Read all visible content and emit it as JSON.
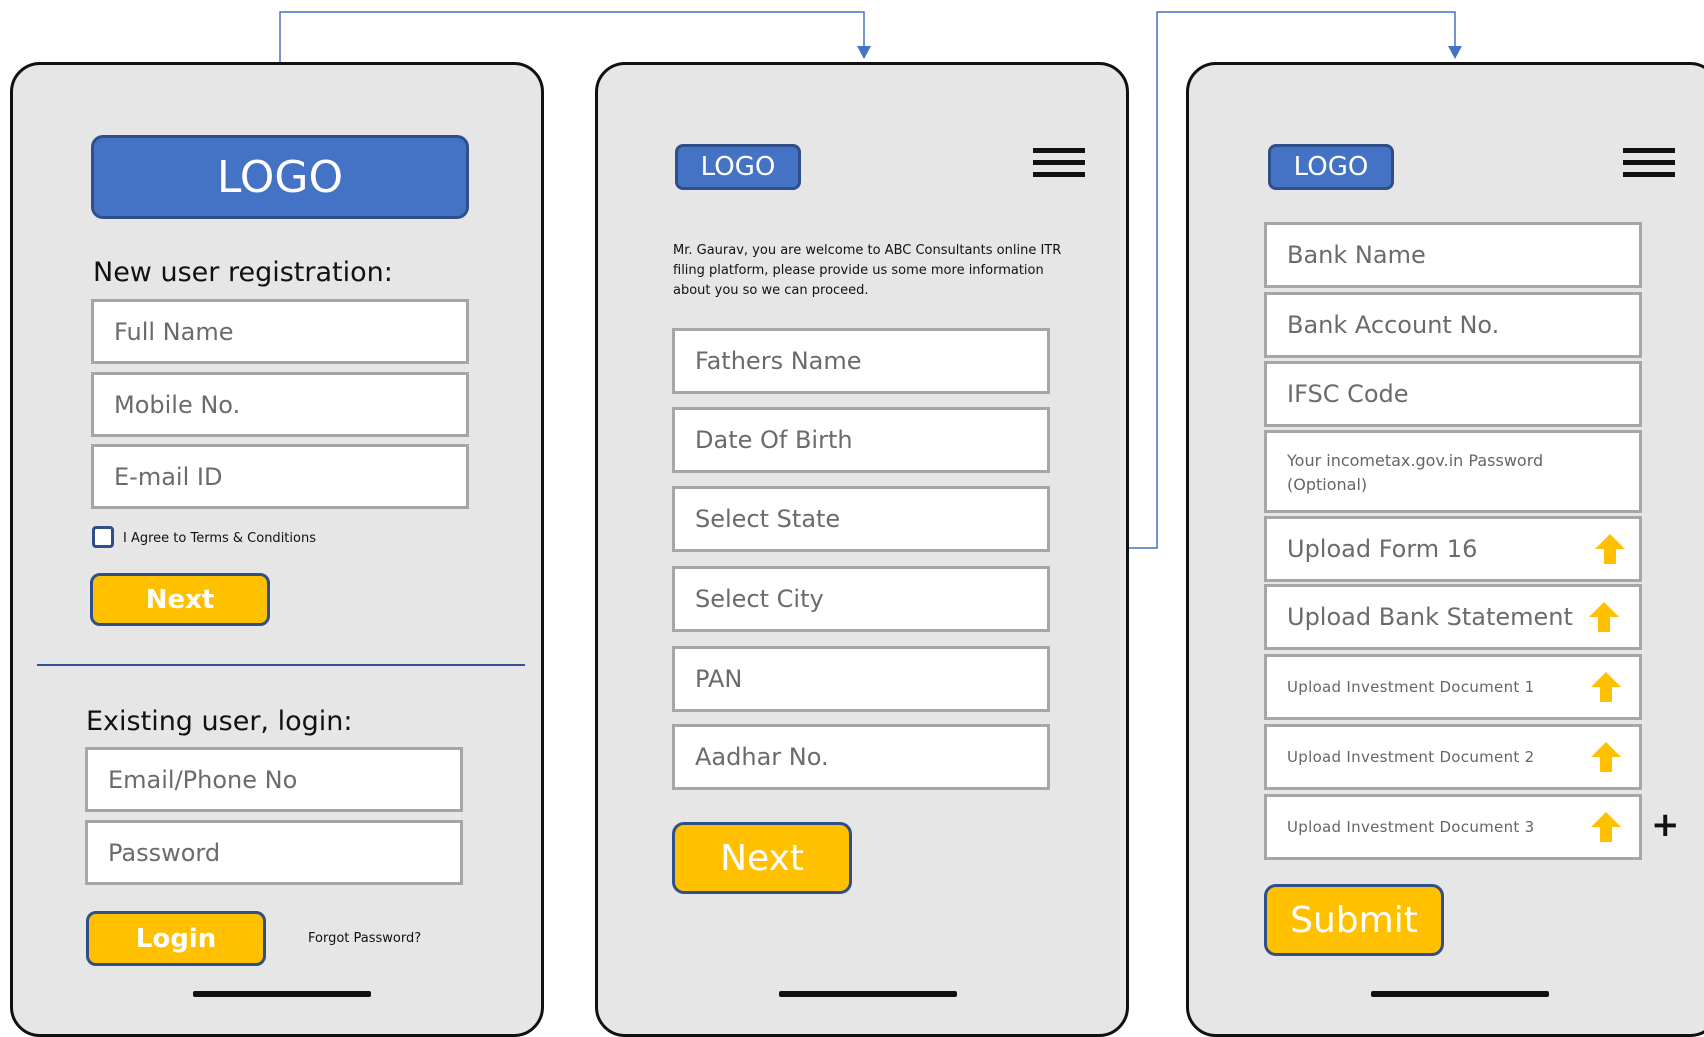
{
  "screen1": {
    "logo": "LOGO",
    "registration_heading": "New user registration:",
    "full_name_placeholder": "Full Name",
    "mobile_placeholder": "Mobile No.",
    "email_placeholder": "E-mail ID",
    "terms_label": "I Agree to Terms & Conditions",
    "next_label": "Next",
    "login_heading": "Existing user, login:",
    "login_id_placeholder": "Email/Phone No",
    "password_placeholder": "Password",
    "login_label": "Login",
    "forgot_password": "Forgot Password?"
  },
  "screen2": {
    "logo": "LOGO",
    "welcome_text": "Mr. Gaurav, you are welcome to ABC Consultants online ITR filing platform, please provide us some more information about you so we can proceed.",
    "fields": [
      "Fathers Name",
      "Date Of Birth",
      "Select State",
      "Select City",
      "PAN",
      "Aadhar No."
    ],
    "next_label": "Next"
  },
  "screen3": {
    "logo": "LOGO",
    "fields": [
      "Bank Name",
      "Bank Account No.",
      "IFSC Code",
      "Your incometax.gov.in Password (Optional)"
    ],
    "uploads": [
      "Upload Form 16",
      "Upload Bank Statement",
      "Upload Investment Document 1",
      "Upload Investment Document 2",
      "Upload Investment Document 3"
    ],
    "add_symbol": "+",
    "submit_label": "Submit"
  },
  "icons": {
    "upload": "upload-arrow-icon",
    "menu": "hamburger-menu-icon",
    "connector_color": "#4472c4",
    "button_color": "#ffc000",
    "logo_color": "#4472c4"
  }
}
